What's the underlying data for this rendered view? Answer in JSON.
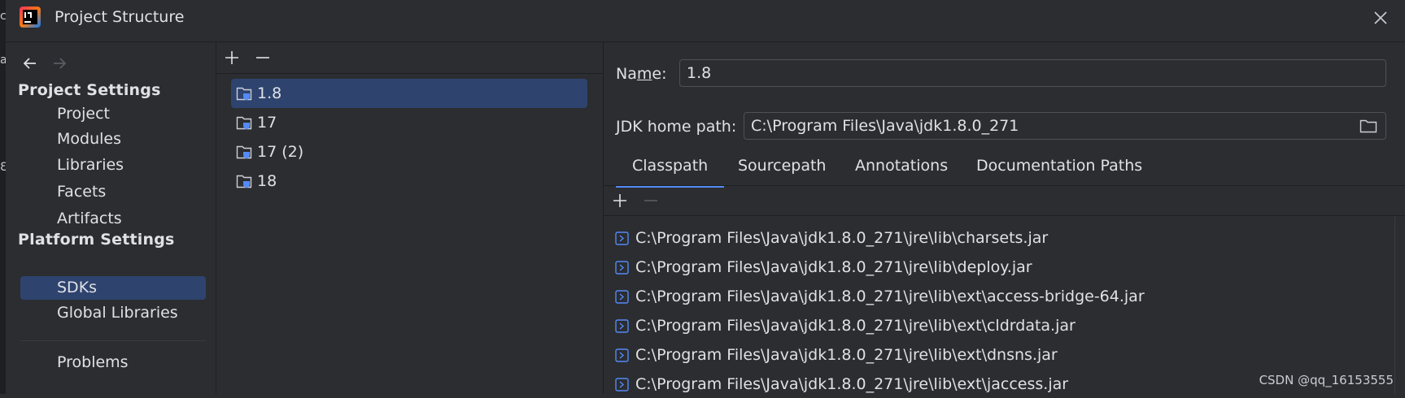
{
  "window": {
    "title": "Project Structure"
  },
  "edge_glyphs": [
    "c",
    "a",
    "Ɛ"
  ],
  "nav": {
    "project_settings_heading": "Project Settings",
    "project_items": [
      "Project",
      "Modules",
      "Libraries",
      "Facets",
      "Artifacts"
    ],
    "platform_settings_heading": "Platform Settings",
    "platform_items": [
      "SDKs",
      "Global Libraries"
    ],
    "selected": "SDKs",
    "problems": "Problems"
  },
  "sdks": {
    "items": [
      "1.8",
      "17",
      "17 (2)",
      "18"
    ],
    "selected": "1.8"
  },
  "details": {
    "name_label_pre": "Na",
    "name_label_mnemonic": "m",
    "name_label_post": "e:",
    "name_value": "1.8",
    "jdk_home_label": "JDK home path:",
    "jdk_home_value": "C:\\Program Files\\Java\\jdk1.8.0_271",
    "tabs": [
      "Classpath",
      "Sourcepath",
      "Annotations",
      "Documentation Paths"
    ],
    "active_tab": "Classpath",
    "classpath": [
      "C:\\Program Files\\Java\\jdk1.8.0_271\\jre\\lib\\charsets.jar",
      "C:\\Program Files\\Java\\jdk1.8.0_271\\jre\\lib\\deploy.jar",
      "C:\\Program Files\\Java\\jdk1.8.0_271\\jre\\lib\\ext\\access-bridge-64.jar",
      "C:\\Program Files\\Java\\jdk1.8.0_271\\jre\\lib\\ext\\cldrdata.jar",
      "C:\\Program Files\\Java\\jdk1.8.0_271\\jre\\lib\\ext\\dnsns.jar",
      "C:\\Program Files\\Java\\jdk1.8.0_271\\jre\\lib\\ext\\jaccess.jar"
    ]
  },
  "watermark": "CSDN @qq_16153555",
  "colors": {
    "background": "#2b2d30",
    "selection": "#2e436e",
    "accent": "#548af7",
    "text": "#dfe1e5"
  }
}
